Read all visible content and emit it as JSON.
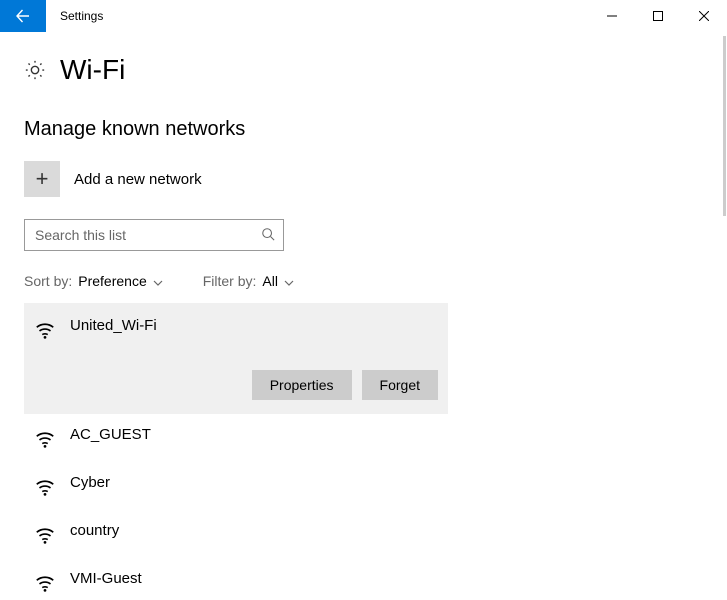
{
  "window": {
    "title": "Settings"
  },
  "page": {
    "title": "Wi-Fi",
    "section_title": "Manage known networks",
    "add_network_label": "Add a new network",
    "search_placeholder": "Search this list",
    "sort_label": "Sort by:",
    "sort_value": "Preference",
    "filter_label": "Filter by:",
    "filter_value": "All",
    "properties_label": "Properties",
    "forget_label": "Forget"
  },
  "networks": [
    {
      "name": "United_Wi-Fi",
      "selected": true
    },
    {
      "name": "AC_GUEST",
      "selected": false
    },
    {
      "name": "Cyber",
      "selected": false
    },
    {
      "name": "country",
      "selected": false
    },
    {
      "name": "VMI-Guest",
      "selected": false
    }
  ]
}
